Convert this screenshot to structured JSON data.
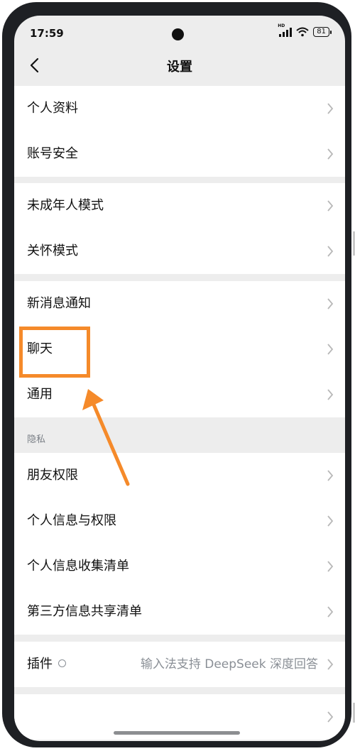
{
  "status_bar": {
    "time": "17:59",
    "network_badge": "HD",
    "battery": "81"
  },
  "header": {
    "title": "设置"
  },
  "menu": {
    "personal_info": "个人资料",
    "account_security": "账号安全",
    "minor_mode": "未成年人模式",
    "care_mode": "关怀模式",
    "notifications": "新消息通知",
    "chat": "聊天",
    "general": "通用",
    "privacy_section": "隐私",
    "friend_permissions": "朋友权限",
    "personal_info_permissions": "个人信息与权限",
    "personal_info_collection": "个人信息收集清单",
    "third_party_sharing": "第三方信息共享清单",
    "plugins": "插件",
    "plugins_value": "输入法支持 DeepSeek 深度回答"
  },
  "colors": {
    "highlight": "#f58a2a",
    "background": "#ededed",
    "row": "#ffffff"
  }
}
